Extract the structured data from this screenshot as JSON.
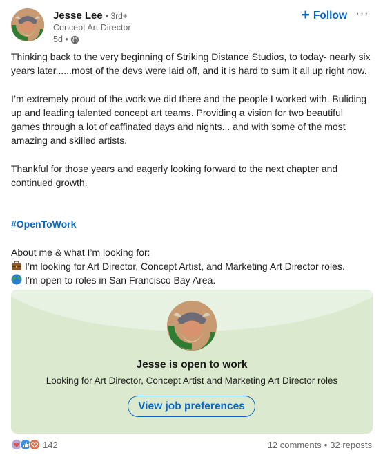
{
  "author": {
    "name": "Jesse Lee",
    "degree": "• 3rd+",
    "headline": "Concept Art Director",
    "time": "5d •",
    "visibility_icon": "globe-icon",
    "avatar_badge": "#OPENTOWORK"
  },
  "actions": {
    "follow_icon": "+",
    "follow_label": "Follow",
    "more_label": "···"
  },
  "post": {
    "paragraphs": [
      "Thinking back to the very beginning of Striking Distance Studios, to today- nearly six years later......most of the devs were laid off, and it is hard to sum it all up right now.",
      "I’m extremely proud of the work we did there and the people I worked with. Buliding up and leading talented concept art teams. Providing a vision for two beautiful games through a lot of caffinated days and nights... and with some of the most amazing and skilled artists.",
      "Thankful for those years and eagerly looking forward to the next chapter and continued growth."
    ],
    "hashtag": "#OpenToWork",
    "about_heading": "About me & what I’m looking for:",
    "about_items": [
      {
        "icon": "briefcase-icon",
        "text": "I’m looking for Art Director, Concept Artist, and Marketing Art Director roles."
      },
      {
        "icon": "globe-icon",
        "text": "I’m open to roles in San Francisco Bay Area."
      }
    ]
  },
  "open_to_work_card": {
    "title": "Jesse is open to work",
    "subtitle": "Looking for Art Director, Concept Artist and Marketing Art Director roles",
    "button_label": "View job preferences",
    "colors": {
      "background": "#dbeacf",
      "arc": "#e8f2e2",
      "badge": "#2e7d32",
      "accent": "#0a66c2"
    }
  },
  "social": {
    "reaction_icons": [
      "support-icon",
      "like-icon",
      "love-icon"
    ],
    "reaction_count": "142",
    "comments": "12 comments",
    "separator": "•",
    "reposts": "32 reposts"
  }
}
